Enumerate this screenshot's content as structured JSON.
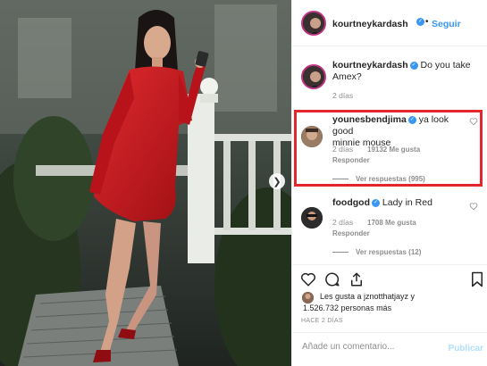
{
  "post": {
    "author": "kourtneykardash",
    "follow_label": "Seguir",
    "caption": {
      "username": "kourtneykardash",
      "text_line1": "Do you take",
      "text_line2": "Amex?",
      "time": "2 días"
    }
  },
  "comments": [
    {
      "username": "younesbendjima",
      "text_line1": "ya look good",
      "text_line2": "minnie mouse",
      "time": "2 días",
      "likes": "19132 Me gusta",
      "reply_label": "Responder",
      "view_replies": "Ver respuestas (995)"
    },
    {
      "username": "foodgod",
      "text_line1": "Lady in Red",
      "time": "2 días",
      "likes": "1708 Me gusta",
      "reply_label": "Responder",
      "view_replies": "Ver respuestas (12)"
    }
  ],
  "likes_summary": {
    "line1": "Les gusta a jznotthatjayz y",
    "line2": "1.526.732 personas más"
  },
  "posted_ago": "HACE 2 DÍAS",
  "add_comment": {
    "placeholder": "Añade un comentario...",
    "publish_label": "Publicar"
  },
  "colors": {
    "accent": "#3897f0",
    "highlight": "#e3262d",
    "dress": "#c4161c"
  }
}
